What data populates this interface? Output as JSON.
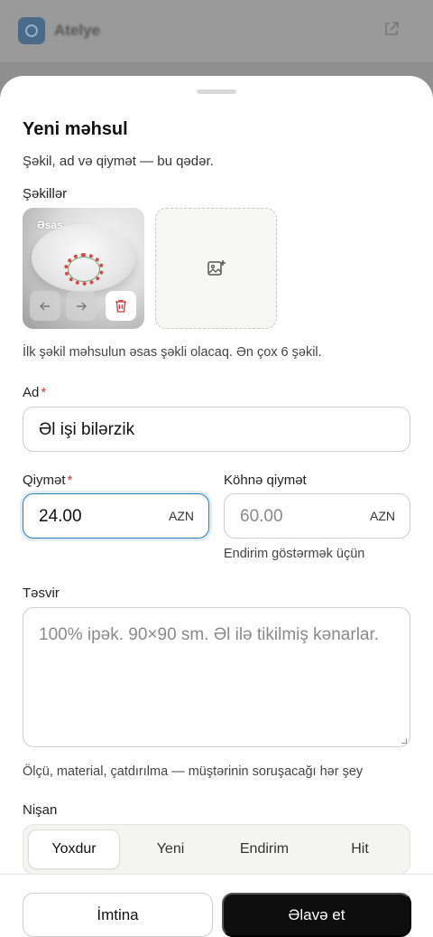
{
  "background": {
    "app_title": "Atelye"
  },
  "sheet": {
    "title": "Yeni məhsul",
    "subtitle": "Şəkil, ad və qiymət — bu qədər.",
    "images": {
      "label": "Şəkillər",
      "main_badge": "Əsas",
      "hint": "İlk şəkil məhsulun əsas şəkli olacaq. Ən çox 6 şəkil.",
      "icons": {
        "left": "arrow-left-icon",
        "right": "arrow-right-icon",
        "delete": "trash-icon",
        "add": "image-plus-icon"
      }
    },
    "name": {
      "label": "Ad",
      "required_mark": "*",
      "value": "Əl işi bilərzik"
    },
    "price": {
      "label": "Qiymət",
      "required_mark": "*",
      "value": "24.00",
      "unit": "AZN"
    },
    "old_price": {
      "label": "Köhnə qiymət",
      "placeholder": "60.00",
      "unit": "AZN",
      "hint": "Endirim göstərmək üçün"
    },
    "description": {
      "label": "Təsvir",
      "placeholder": "100% ipək. 90×90 sm. Əl ilə tikilmiş kənarlar.",
      "hint": "Ölçü, material, çatdırılma — müştərinin soruşacağı hər şey"
    },
    "badge": {
      "label": "Nişan",
      "options": [
        "Yoxdur",
        "Yeni",
        "Endirim",
        "Hit"
      ],
      "selected": "Yoxdur"
    },
    "footer": {
      "cancel_label": "İmtina",
      "submit_label": "Əlavə et"
    }
  },
  "colors": {
    "accent_focus": "#2c7fb8",
    "required": "#d23a3a",
    "primary_button": "#0e0e0e",
    "delete_icon": "#c63a3a"
  }
}
